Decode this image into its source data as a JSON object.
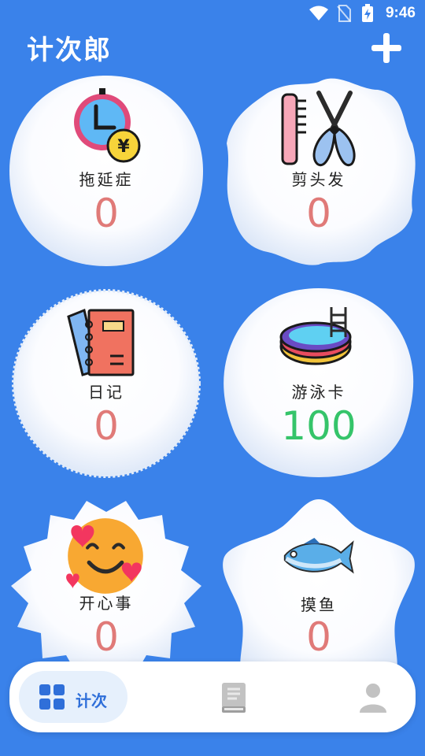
{
  "status": {
    "time": "9:46"
  },
  "app": {
    "title": "计次郎"
  },
  "counters": [
    {
      "name": "拖延症",
      "count": "0",
      "icon": "clock-yen-icon"
    },
    {
      "name": "剪头发",
      "count": "0",
      "icon": "comb-scissors-icon"
    },
    {
      "name": "日记",
      "count": "0",
      "icon": "notebook-icon"
    },
    {
      "name": "游泳卡",
      "count": "100",
      "icon": "swimming-pool-icon"
    },
    {
      "name": "开心事",
      "count": "0",
      "icon": "smiling-face-hearts-icon"
    },
    {
      "name": "摸鱼",
      "count": "0",
      "icon": "fish-icon"
    }
  ],
  "colors": {
    "background": "#3a82ea",
    "count_zero": "#e07a78",
    "count_positive": "#35c46a",
    "tab_active": "#2f6fd9"
  },
  "tabs": [
    {
      "label": "计次",
      "icon": "grid-icon",
      "active": true
    },
    {
      "label": "",
      "icon": "book-icon",
      "active": false
    },
    {
      "label": "",
      "icon": "person-icon",
      "active": false
    }
  ]
}
